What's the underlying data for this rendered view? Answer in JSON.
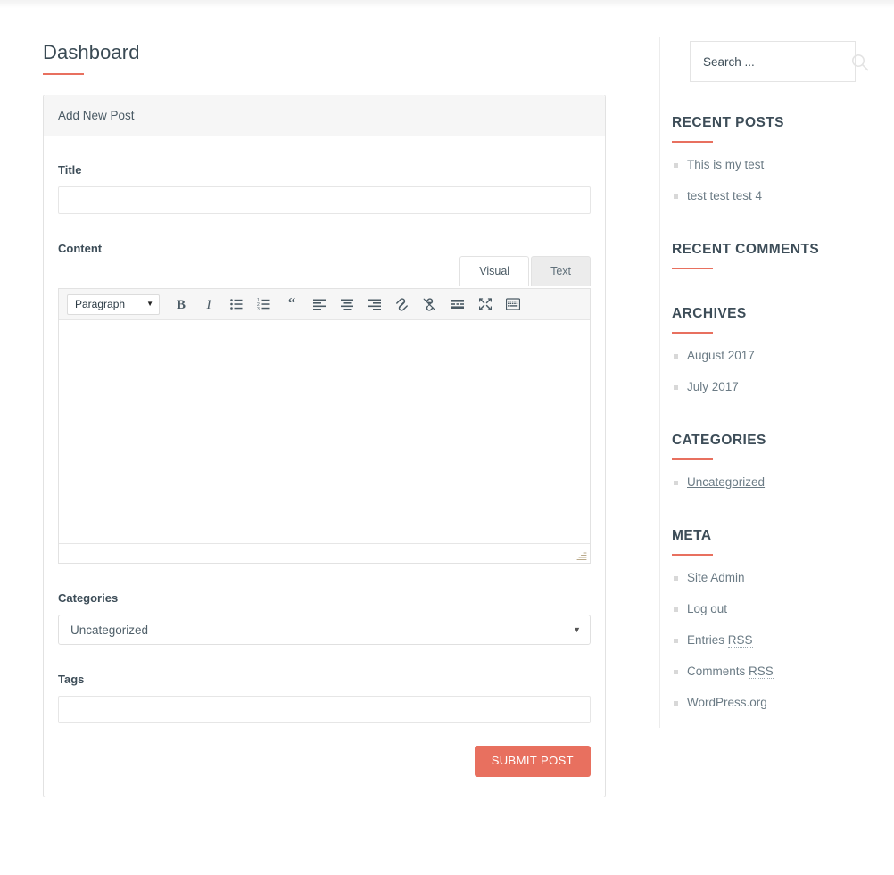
{
  "page": {
    "title": "Dashboard",
    "accent_color": "#e8705f",
    "heading_color": "#3d4d58"
  },
  "panel": {
    "header": "Add New Post",
    "fields": {
      "title_label": "Title",
      "title_value": "",
      "title_placeholder": "",
      "content_label": "Content",
      "categories_label": "Categories",
      "categories_selected": "Uncategorized",
      "categories_options": [
        "Uncategorized"
      ],
      "tags_label": "Tags",
      "tags_value": "",
      "tags_placeholder": ""
    },
    "editor": {
      "tabs": [
        {
          "label": "Visual",
          "active": true
        },
        {
          "label": "Text",
          "active": false
        }
      ],
      "format_select": "Paragraph",
      "content_value": "",
      "toolbar_icons": [
        "bold-icon",
        "italic-icon",
        "bulleted-list-icon",
        "numbered-list-icon",
        "blockquote-icon",
        "align-left-icon",
        "align-center-icon",
        "align-right-icon",
        "insert-link-icon",
        "remove-link-icon",
        "insert-read-more-icon",
        "fullscreen-icon",
        "toolbar-toggle-icon"
      ]
    },
    "submit_label": "SUBMIT POST"
  },
  "sidebar": {
    "search": {
      "placeholder": "Search ...",
      "value": "",
      "icon": "search-icon"
    },
    "widgets": [
      {
        "title": "RECENT POSTS",
        "items": [
          {
            "label": "This is my test",
            "underlined": false
          },
          {
            "label": "test test test 4",
            "underlined": false
          }
        ]
      },
      {
        "title": "RECENT COMMENTS",
        "items": []
      },
      {
        "title": "ARCHIVES",
        "items": [
          {
            "label": "August 2017",
            "underlined": false
          },
          {
            "label": "July 2017",
            "underlined": false
          }
        ]
      },
      {
        "title": "CATEGORIES",
        "items": [
          {
            "label": "Uncategorized",
            "underlined": true
          }
        ]
      },
      {
        "title": "META",
        "items": [
          {
            "label": "Site Admin",
            "underlined": false
          },
          {
            "label": "Log out",
            "underlined": false
          },
          {
            "label": "Entries RSS",
            "underlined": false,
            "abbr": "RSS"
          },
          {
            "label": "Comments RSS",
            "underlined": false,
            "abbr": "RSS"
          },
          {
            "label": "WordPress.org",
            "underlined": false
          }
        ]
      }
    ]
  }
}
